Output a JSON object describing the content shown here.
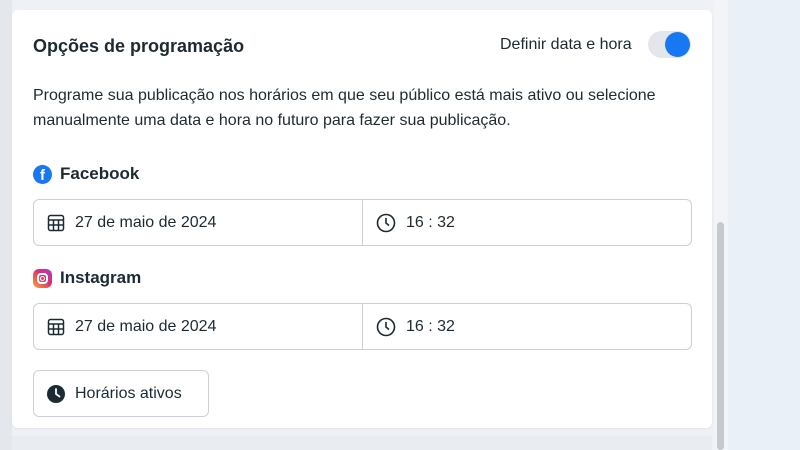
{
  "scheduling": {
    "title": "Opções de programação",
    "toggle_label": "Definir data e hora",
    "toggle_on": true,
    "description": "Programe sua publicação nos horários em que seu público está mais ativo ou selecione manualmente uma data e hora no futuro para fazer sua publicação.",
    "accent_color": "#1877f2"
  },
  "facebook": {
    "label": "Facebook",
    "date": "27 de maio de 2024",
    "time": "16 : 32",
    "icon": "facebook-icon"
  },
  "instagram": {
    "label": "Instagram",
    "date": "27 de maio de 2024",
    "time": "16 : 32",
    "icon": "instagram-icon"
  },
  "active_times_button": {
    "label": "Horários ativos",
    "icon": "clock-icon"
  }
}
